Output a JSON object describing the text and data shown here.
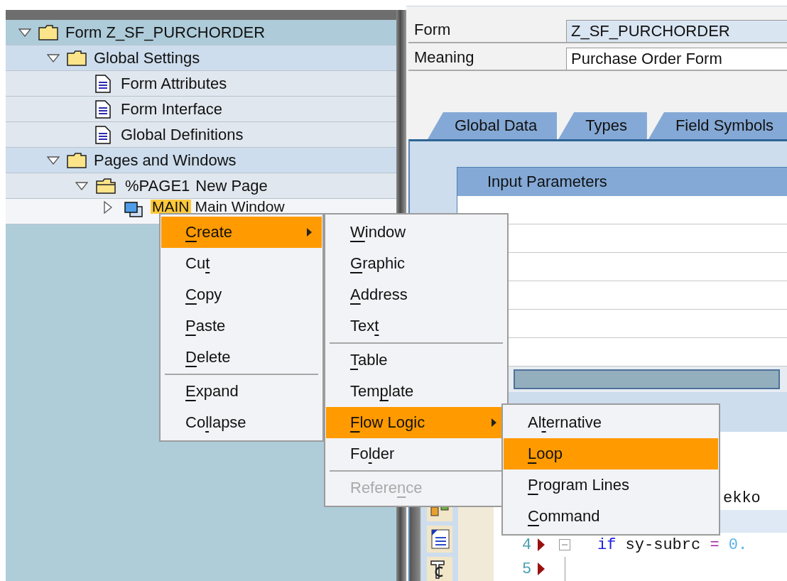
{
  "tree": [
    {
      "kind": "form",
      "label": "Form Z_SF_PURCHORDER",
      "expanded": true,
      "selected": false,
      "children": [
        {
          "kind": "folder",
          "label": "Global Settings",
          "expanded": true,
          "selected": false,
          "children": [
            {
              "kind": "doc",
              "label": "Form Attributes",
              "selected": false
            },
            {
              "kind": "doc",
              "label": "Form Interface",
              "selected": false
            },
            {
              "kind": "doc",
              "label": "Global Definitions",
              "selected": false
            }
          ]
        },
        {
          "kind": "folder",
          "label": "Pages and Windows",
          "expanded": true,
          "selected": false,
          "children": [
            {
              "kind": "page",
              "code": "%PAGE1",
              "label": "New Page",
              "expanded": true,
              "selected": false,
              "children": [
                {
                  "kind": "window",
                  "code": "MAIN",
                  "label": "Main Window",
                  "expanded": false,
                  "selected": true
                }
              ]
            }
          ]
        }
      ]
    }
  ],
  "header": {
    "fields": [
      {
        "label": "Form",
        "value": "Z_SF_PURCHORDER",
        "readonly": true
      },
      {
        "label": "Meaning",
        "value": "Purchase Order Form",
        "readonly": false
      }
    ]
  },
  "tabs": [
    {
      "label": "Global Data"
    },
    {
      "label": "Types"
    },
    {
      "label": "Field Symbols"
    }
  ],
  "parameters_table": {
    "title": "Input Parameters"
  },
  "code": {
    "lines": [
      {
        "kind": "code",
        "tokens": [
          {
            "text": "ekko",
            "kind": "plain"
          }
        ]
      },
      {
        "kind": "current"
      },
      {
        "kind": "code",
        "number": "4",
        "fold": true,
        "tokens": [
          {
            "text": "if",
            "kind": "keyword"
          },
          {
            "text": " sy-subrc ",
            "kind": "plain"
          },
          {
            "text": "=",
            "kind": "operator"
          },
          {
            "text": " 0.",
            "kind": "number"
          }
        ]
      },
      {
        "kind": "code",
        "number": "5",
        "fold": false
      }
    ]
  },
  "menus": [
    {
      "items": [
        {
          "kind": "item",
          "label": {
            "key": "C",
            "after": "reate"
          },
          "highlighted": true,
          "submenu": true,
          "disabled": false
        },
        {
          "kind": "item",
          "label": {
            "before": "Cu",
            "key": "t"
          },
          "highlighted": false,
          "submenu": false,
          "disabled": false
        },
        {
          "kind": "item",
          "label": {
            "key": "C",
            "after": "opy"
          },
          "highlighted": false,
          "submenu": false,
          "disabled": false
        },
        {
          "kind": "item",
          "label": {
            "key": "P",
            "after": "aste"
          },
          "highlighted": false,
          "submenu": false,
          "disabled": false
        },
        {
          "kind": "item",
          "label": {
            "key": "D",
            "after": "elete"
          },
          "highlighted": false,
          "submenu": false,
          "disabled": false
        },
        {
          "kind": "separator"
        },
        {
          "kind": "item",
          "label": {
            "key": "E",
            "after": "xpand"
          },
          "highlighted": false,
          "submenu": false,
          "disabled": false
        },
        {
          "kind": "item",
          "label": {
            "before": "Co",
            "key": "l",
            "after": "lapse"
          },
          "highlighted": false,
          "submenu": false,
          "disabled": false
        }
      ]
    },
    {
      "items": [
        {
          "kind": "item",
          "label": {
            "key": "W",
            "after": "indow"
          },
          "highlighted": false,
          "submenu": false,
          "disabled": false
        },
        {
          "kind": "item",
          "label": {
            "key": "G",
            "after": "raphic"
          },
          "highlighted": false,
          "submenu": false,
          "disabled": false
        },
        {
          "kind": "item",
          "label": {
            "key": "A",
            "after": "ddress"
          },
          "highlighted": false,
          "submenu": false,
          "disabled": false
        },
        {
          "kind": "item",
          "label": {
            "before": "Tex",
            "key": "t"
          },
          "highlighted": false,
          "submenu": false,
          "disabled": false
        },
        {
          "kind": "separator"
        },
        {
          "kind": "item",
          "label": {
            "key": "T",
            "after": "able"
          },
          "highlighted": false,
          "submenu": false,
          "disabled": false
        },
        {
          "kind": "item",
          "label": {
            "before": "Tem",
            "key": "p",
            "after": "late"
          },
          "highlighted": false,
          "submenu": false,
          "disabled": false
        },
        {
          "kind": "item",
          "label": {
            "key": "F",
            "after": "low Logic"
          },
          "highlighted": true,
          "submenu": true,
          "disabled": false
        },
        {
          "kind": "item",
          "label": {
            "before": "Fo",
            "key": "l",
            "after": "der"
          },
          "highlighted": false,
          "submenu": false,
          "disabled": false
        },
        {
          "kind": "separator"
        },
        {
          "kind": "item",
          "label": {
            "before": "Refere",
            "key": "n",
            "after": "ce"
          },
          "highlighted": false,
          "submenu": false,
          "disabled": true
        }
      ]
    },
    {
      "items": [
        {
          "kind": "item",
          "label": {
            "before": "Al",
            "key": "t",
            "after": "ernative"
          },
          "highlighted": false,
          "submenu": false,
          "disabled": false
        },
        {
          "kind": "item",
          "label": {
            "key": "L",
            "after": "oop"
          },
          "highlighted": true,
          "submenu": false,
          "disabled": false
        },
        {
          "kind": "item",
          "label": {
            "key": "P",
            "after": "rogram Lines"
          },
          "highlighted": false,
          "submenu": false,
          "disabled": false
        },
        {
          "kind": "item",
          "label": {
            "key": "C",
            "after": "ommand"
          },
          "highlighted": false,
          "submenu": false,
          "disabled": false
        }
      ]
    }
  ]
}
